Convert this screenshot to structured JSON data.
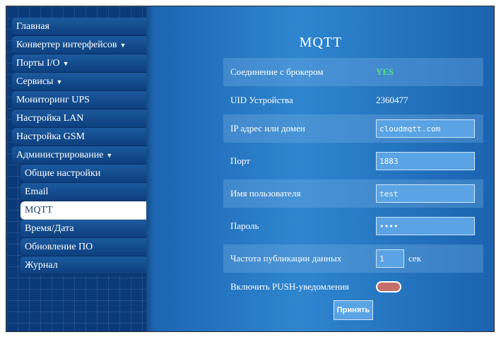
{
  "sidebar": {
    "items": [
      {
        "label": "Главная",
        "caret": ""
      },
      {
        "label": "Конвертер интерфейсов",
        "caret": "▼"
      },
      {
        "label": "Порты I/O",
        "caret": "▼"
      },
      {
        "label": "Сервисы",
        "caret": "▼"
      },
      {
        "label": "Мониторинг UPS",
        "caret": ""
      },
      {
        "label": "Настройка LAN",
        "caret": ""
      },
      {
        "label": "Настройка GSM",
        "caret": ""
      },
      {
        "label": "Администрирование",
        "caret": "▼"
      }
    ],
    "subitems": [
      {
        "label": "Общие настройки"
      },
      {
        "label": "Email"
      },
      {
        "label": "MQTT"
      },
      {
        "label": "Время/Дата"
      },
      {
        "label": "Обновление ПО"
      },
      {
        "label": "Журнал"
      }
    ]
  },
  "main": {
    "title": "MQTT",
    "connection": {
      "label": "Соединение с брокером",
      "value": "YES"
    },
    "uid": {
      "label": "UID Устройства",
      "value": "2360477"
    },
    "host": {
      "label": "IP адрес или домен",
      "value": "cloudmqtt.com"
    },
    "port": {
      "label": "Порт",
      "value": "1883"
    },
    "username": {
      "label": "Имя пользователя",
      "value": "test"
    },
    "password": {
      "label": "Пароль",
      "value": "••••"
    },
    "publish_rate": {
      "label": "Частота публикации данных",
      "value": "1",
      "unit": "сек"
    },
    "push": {
      "label": "Включить PUSH-уведомления",
      "enabled": false
    },
    "submit_label": "Принять"
  },
  "colors": {
    "accent": "#5aa3e4",
    "status_ok": "#4fe08a",
    "toggle_off": "#c56f6a"
  }
}
